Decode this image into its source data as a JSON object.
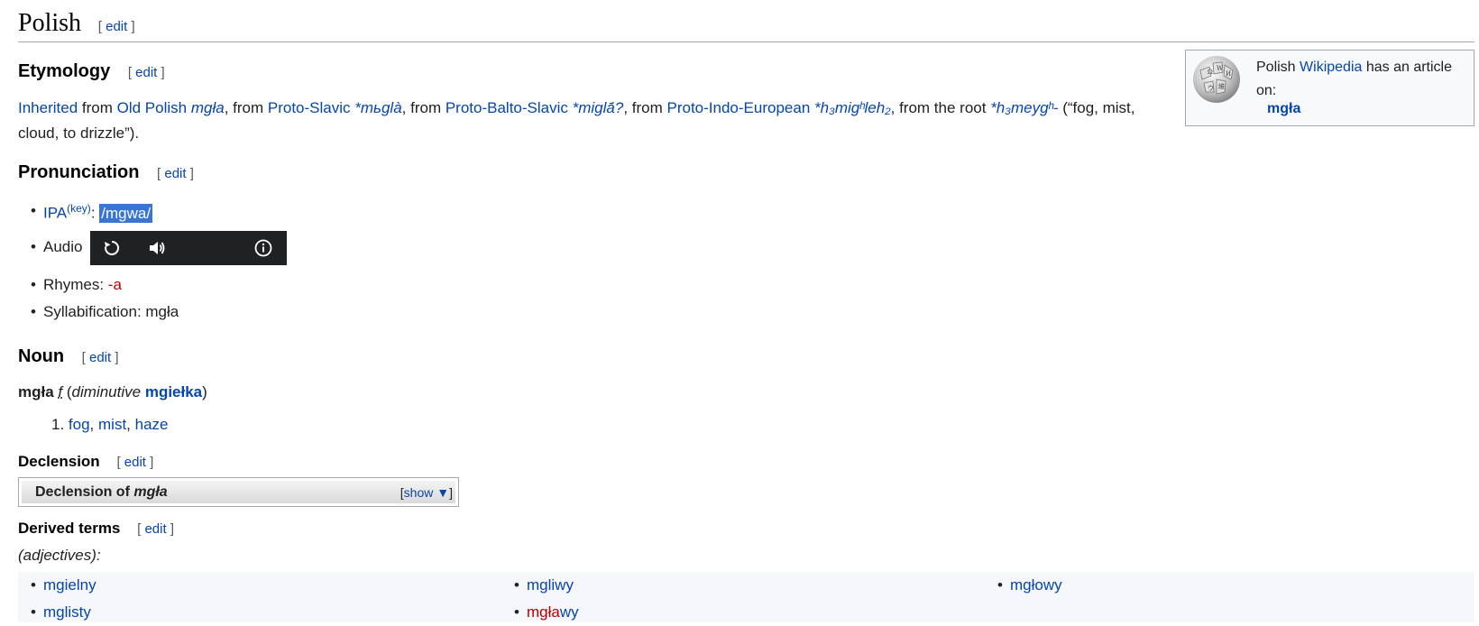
{
  "section": {
    "title": "Polish",
    "edit": "edit"
  },
  "etymology": {
    "heading": "Etymology",
    "edit": "edit",
    "l1_inherited": "Inherited",
    "l1_from1": " from ",
    "l1_old_polish": "Old Polish",
    "l1_sp1": " ",
    "l1_mgla": "mgła",
    "l1_from2": ", from ",
    "l1_proto_slavic": "Proto-Slavic",
    "l1_sp2": " ",
    "l1_mbgla": "*mьglà",
    "l1_from3": ", from ",
    "l1_pbs": "Proto-Balto-Slavic",
    "l1_sp3": " ",
    "l1_migla": "*miglā́?",
    "l1_from4": ", from ",
    "l1_pie": "Proto-Indo-European",
    "l1_sp4": " ",
    "l1_root1": "*h₃migʰleh₂",
    "l1_from5": ", from the root ",
    "l1_root2": "*h₃meygʰ-",
    "l1_gloss_a": " (“fog, mist,",
    "l2_gloss_b": "cloud, to drizzle”)."
  },
  "infobox": {
    "text_pre": "Polish ",
    "wikipedia": "Wikipedia",
    "text_post": " has an article on:",
    "article": "mgła"
  },
  "pronunciation": {
    "heading": "Pronunciation",
    "edit": "edit",
    "ipa_label": "IPA",
    "ipa_key": "(key)",
    "ipa_colon": ": ",
    "ipa_value": "/mɡwa/",
    "audio_label": "Audio",
    "rhymes_label": "Rhymes: ",
    "rhymes_value": "-a",
    "syll_label": "Syllabification: ",
    "syll_value": "mgła"
  },
  "player": {
    "replay_icon": "replay-icon",
    "volume_icon": "volume-icon",
    "info_icon": "info-icon"
  },
  "noun": {
    "heading": "Noun",
    "edit": "edit",
    "headword": "mgła",
    "gender": "f",
    "dim_open": " (",
    "dim_label": "diminutive",
    "dim_sp": " ",
    "dim_word": "mgiełka",
    "dim_close": ")",
    "sense_num": "1. ",
    "sense_fog": "fog",
    "sense_c1": ", ",
    "sense_mist": "mist",
    "sense_c2": ", ",
    "sense_haze": "haze"
  },
  "declension": {
    "heading": "Declension",
    "edit": "edit",
    "box_title_pre": "Declension of ",
    "box_title_word": "mgła",
    "show_open": "[",
    "show_label": "show ▼",
    "show_close": "]"
  },
  "derived": {
    "heading": "Derived terms",
    "edit": "edit",
    "subhead": "(adjectives):",
    "col1": [
      "mgielny",
      "mglisty"
    ],
    "col2_a": "mgliwy",
    "col2_b_red": "mgła",
    "col2_b_rest": "wy",
    "col3": [
      "mgłowy"
    ]
  }
}
